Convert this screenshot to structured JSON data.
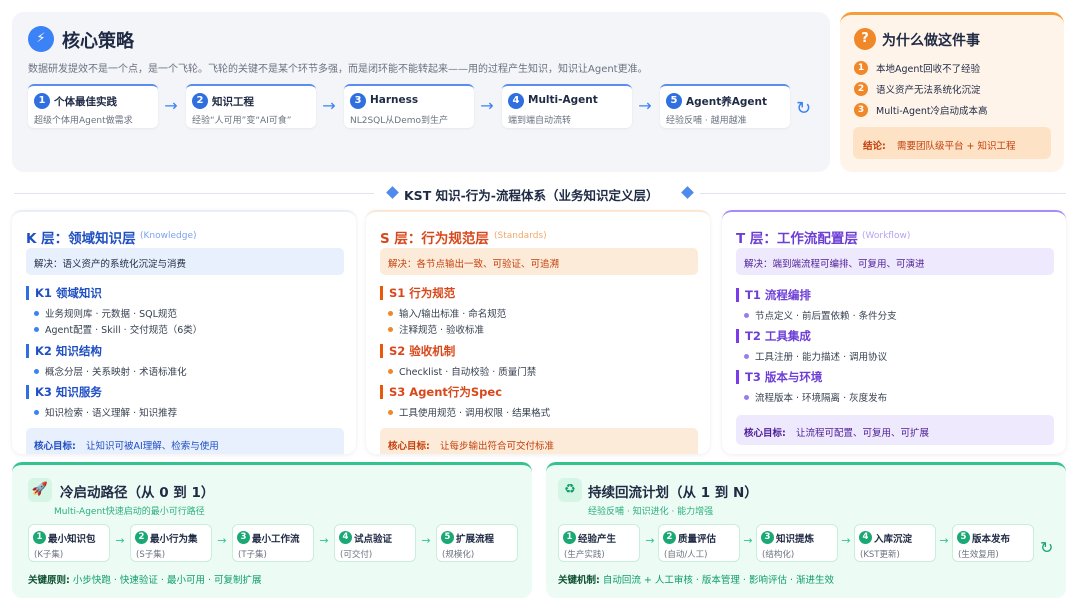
{
  "core": {
    "title": "核心策略",
    "desc": "数据研发提效不是一个点，是一个飞轮。飞轮的关键不是某个环节多强，而是闭环能不能转起来——用的过程产生知识，知识让Agent更准。",
    "steps": [
      {
        "num": "1",
        "label": "个体最佳实践",
        "sub": "超级个体用Agent做需求"
      },
      {
        "num": "2",
        "label": "知识工程",
        "sub": "经验“人可用”变“AI可食”"
      },
      {
        "num": "3",
        "label": "Harness",
        "sub": "NL2SQL从Demo到生产"
      },
      {
        "num": "4",
        "label": "Multi-Agent",
        "sub": "端到端自动流转"
      },
      {
        "num": "5",
        "label": "Agent养Agent",
        "sub": "经验反哺 · 越用越准"
      }
    ]
  },
  "why": {
    "title": "为什么做这件事",
    "items": [
      {
        "num": "1",
        "text": "本地Agent回收不了经验"
      },
      {
        "num": "2",
        "text": "语义资产无法系统化沉淀"
      },
      {
        "num": "3",
        "text": "Multi-Agent冷启动成本高"
      }
    ],
    "conclusion_label": "结论:",
    "conclusion_text": "需要团队级平台 + 知识工程"
  },
  "section": {
    "title": "KST 知识-行为-流程体系（业务知识定义层）"
  },
  "k_layer": {
    "title": "K 层：领域知识层",
    "en": "(Knowledge)",
    "solution": "解决：语义资产的系统化沉淀与消费",
    "groups": [
      {
        "title": "K1 领域知识",
        "items": [
          "业务规则库 · 元数据 · SQL规范",
          "Agent配置 · Skill · 交付规范（6类）"
        ]
      },
      {
        "title": "K2 知识结构",
        "items": [
          "概念分层 · 关系映射 · 术语标准化"
        ]
      },
      {
        "title": "K3 知识服务",
        "items": [
          "知识检索 · 语义理解 · 知识推荐"
        ]
      }
    ],
    "goal_label": "核心目标:",
    "goal_text": "让知识可被AI理解、检索与使用"
  },
  "s_layer": {
    "title": "S 层：行为规范层",
    "en": "(Standards)",
    "solution": "解决：各节点输出一致、可验证、可追溯",
    "groups": [
      {
        "title": "S1 行为规范",
        "items": [
          "输入/输出标准 · 命名规范",
          "注释规范 · 验收标准"
        ]
      },
      {
        "title": "S2 验收机制",
        "items": [
          "Checklist · 自动校验 · 质量门禁"
        ]
      },
      {
        "title": "S3 Agent行为Spec",
        "items": [
          "工具使用规范 · 调用权限 · 结果格式"
        ]
      }
    ],
    "goal_label": "核心目标:",
    "goal_text": "让每步输出符合可交付标准"
  },
  "t_layer": {
    "title": "T 层：工作流配置层",
    "en": "(Workflow)",
    "solution": "解决：端到端流程可编排、可复用、可演进",
    "groups": [
      {
        "title": "T1 流程编排",
        "items": [
          "节点定义 · 前后置依赖 · 条件分支"
        ]
      },
      {
        "title": "T2 工具集成",
        "items": [
          "工具注册 · 能力描述 · 调用协议"
        ]
      },
      {
        "title": "T3 版本与环境",
        "items": [
          "流程版本 · 环境隔离 · 灰度发布"
        ]
      }
    ],
    "goal_label": "核心目标:",
    "goal_text": "让流程可配置、可复用、可扩展"
  },
  "cold_start": {
    "title": "冷启动路径（从 0 到 1）",
    "subtitle": "Multi-Agent快速启动的最小可行路径",
    "steps": [
      {
        "num": "1",
        "label": "最小知识包",
        "sub": "(K子集)"
      },
      {
        "num": "2",
        "label": "最小行为集",
        "sub": "(S子集)"
      },
      {
        "num": "3",
        "label": "最小工作流",
        "sub": "(T子集)"
      },
      {
        "num": "4",
        "label": "试点验证",
        "sub": "(可交付)"
      },
      {
        "num": "5",
        "label": "扩展流程",
        "sub": "(规模化)"
      }
    ],
    "principle_label": "关键原则:",
    "principle_text": "小步快跑 · 快速验证 · 最小可用 · 可复制扩展"
  },
  "reflow": {
    "title": "持续回流计划（从 1 到 N）",
    "subtitle": "经验反哺 · 知识进化 · 能力增强",
    "steps": [
      {
        "num": "1",
        "label": "经验产生",
        "sub": "(生产实践)"
      },
      {
        "num": "2",
        "label": "质量评估",
        "sub": "(自动/人工)"
      },
      {
        "num": "3",
        "label": "知识提炼",
        "sub": "(结构化)"
      },
      {
        "num": "4",
        "label": "入库沉淀",
        "sub": "(KST更新)"
      },
      {
        "num": "5",
        "label": "版本发布",
        "sub": "(生效复用)"
      }
    ],
    "mechanism_label": "关键机制:",
    "mechanism_text": "自动回流 + 人工审核 · 版本管理 · 影响评估 · 渐进生效"
  },
  "colors": {
    "blue": "#2f6fe0",
    "orange": "#f0882a",
    "purple": "#7c3aed",
    "green": "#1aa874"
  },
  "icons": {
    "core": "lightning-icon",
    "why": "question-icon",
    "cold_start": "rocket-icon",
    "reflow": "recycle-icon",
    "cycle": "cycle-arrow-icon"
  }
}
